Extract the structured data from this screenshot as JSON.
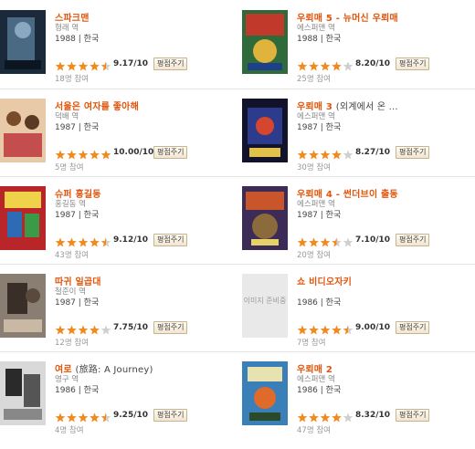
{
  "colors": {
    "title": "#e2550b",
    "star_on": "#f08a1e",
    "star_off": "#cfcfcf"
  },
  "movies": [
    {
      "title": "스파크맨",
      "title_suffix": "",
      "role": "형래 역",
      "year_country": "1988 | 한국",
      "rating": "9.17/10",
      "stars": 4.5,
      "rate_label": "평점주기",
      "votes": "18명 참여",
      "poster": "image"
    },
    {
      "title": "우뢰매 5 - 뉴머신 우뢰매",
      "title_suffix": "",
      "role": "에스퍼맨 역",
      "year_country": "1988 | 한국",
      "rating": "8.20/10",
      "stars": 4,
      "rate_label": "평점주기",
      "votes": "25명 참여",
      "poster": "image"
    },
    {
      "title": "서울은 여자를 좋아해",
      "title_suffix": "",
      "role": "덕배 역",
      "year_country": "1987 | 한국",
      "rating": "10.00/10",
      "stars": 5,
      "rate_label": "평점주기",
      "votes": "5명 참여",
      "poster": "image"
    },
    {
      "title": "우뢰매 3",
      "title_suffix": "(외계에서 온 ...",
      "role": "에스퍼맨 역",
      "year_country": "1987 | 한국",
      "rating": "8.27/10",
      "stars": 4,
      "rate_label": "평점주기",
      "votes": "30명 참여",
      "poster": "image"
    },
    {
      "title": "슈퍼 홍길동",
      "title_suffix": "",
      "role": "홍길동 역",
      "year_country": "1987 | 한국",
      "rating": "9.12/10",
      "stars": 4.5,
      "rate_label": "평점주기",
      "votes": "43명 참여",
      "poster": "image"
    },
    {
      "title": "우뢰매 4 - 썬더브이 출동",
      "title_suffix": "",
      "role": "에스퍼맨 역",
      "year_country": "1987 | 한국",
      "rating": "7.10/10",
      "stars": 3.5,
      "rate_label": "평점주기",
      "votes": "20명 참여",
      "poster": "image"
    },
    {
      "title": "따귀 일곱대",
      "title_suffix": "",
      "role": "철준이 역",
      "year_country": "1987 | 한국",
      "rating": "7.75/10",
      "stars": 4,
      "rate_label": "평점주기",
      "votes": "12명 참여",
      "poster": "image"
    },
    {
      "title": "쇼 비디오자키",
      "title_suffix": "",
      "role": "",
      "year_country": "1986 | 한국",
      "rating": "9.00/10",
      "stars": 4.5,
      "rate_label": "평점주기",
      "votes": "7명 참여",
      "poster": "none",
      "no_image_text": "이미지 준비중"
    },
    {
      "title": "여로",
      "title_suffix": "(旅路: A Journey)",
      "role": "영구 역",
      "year_country": "1986 | 한국",
      "rating": "9.25/10",
      "stars": 4.5,
      "rate_label": "평점주기",
      "votes": "4명 참여",
      "poster": "image"
    },
    {
      "title": "우뢰매 2",
      "title_suffix": "",
      "role": "에스퍼맨 역",
      "year_country": "1986 | 한국",
      "rating": "8.32/10",
      "stars": 4,
      "rate_label": "평점주기",
      "votes": "47명 참여",
      "poster": "image"
    }
  ]
}
